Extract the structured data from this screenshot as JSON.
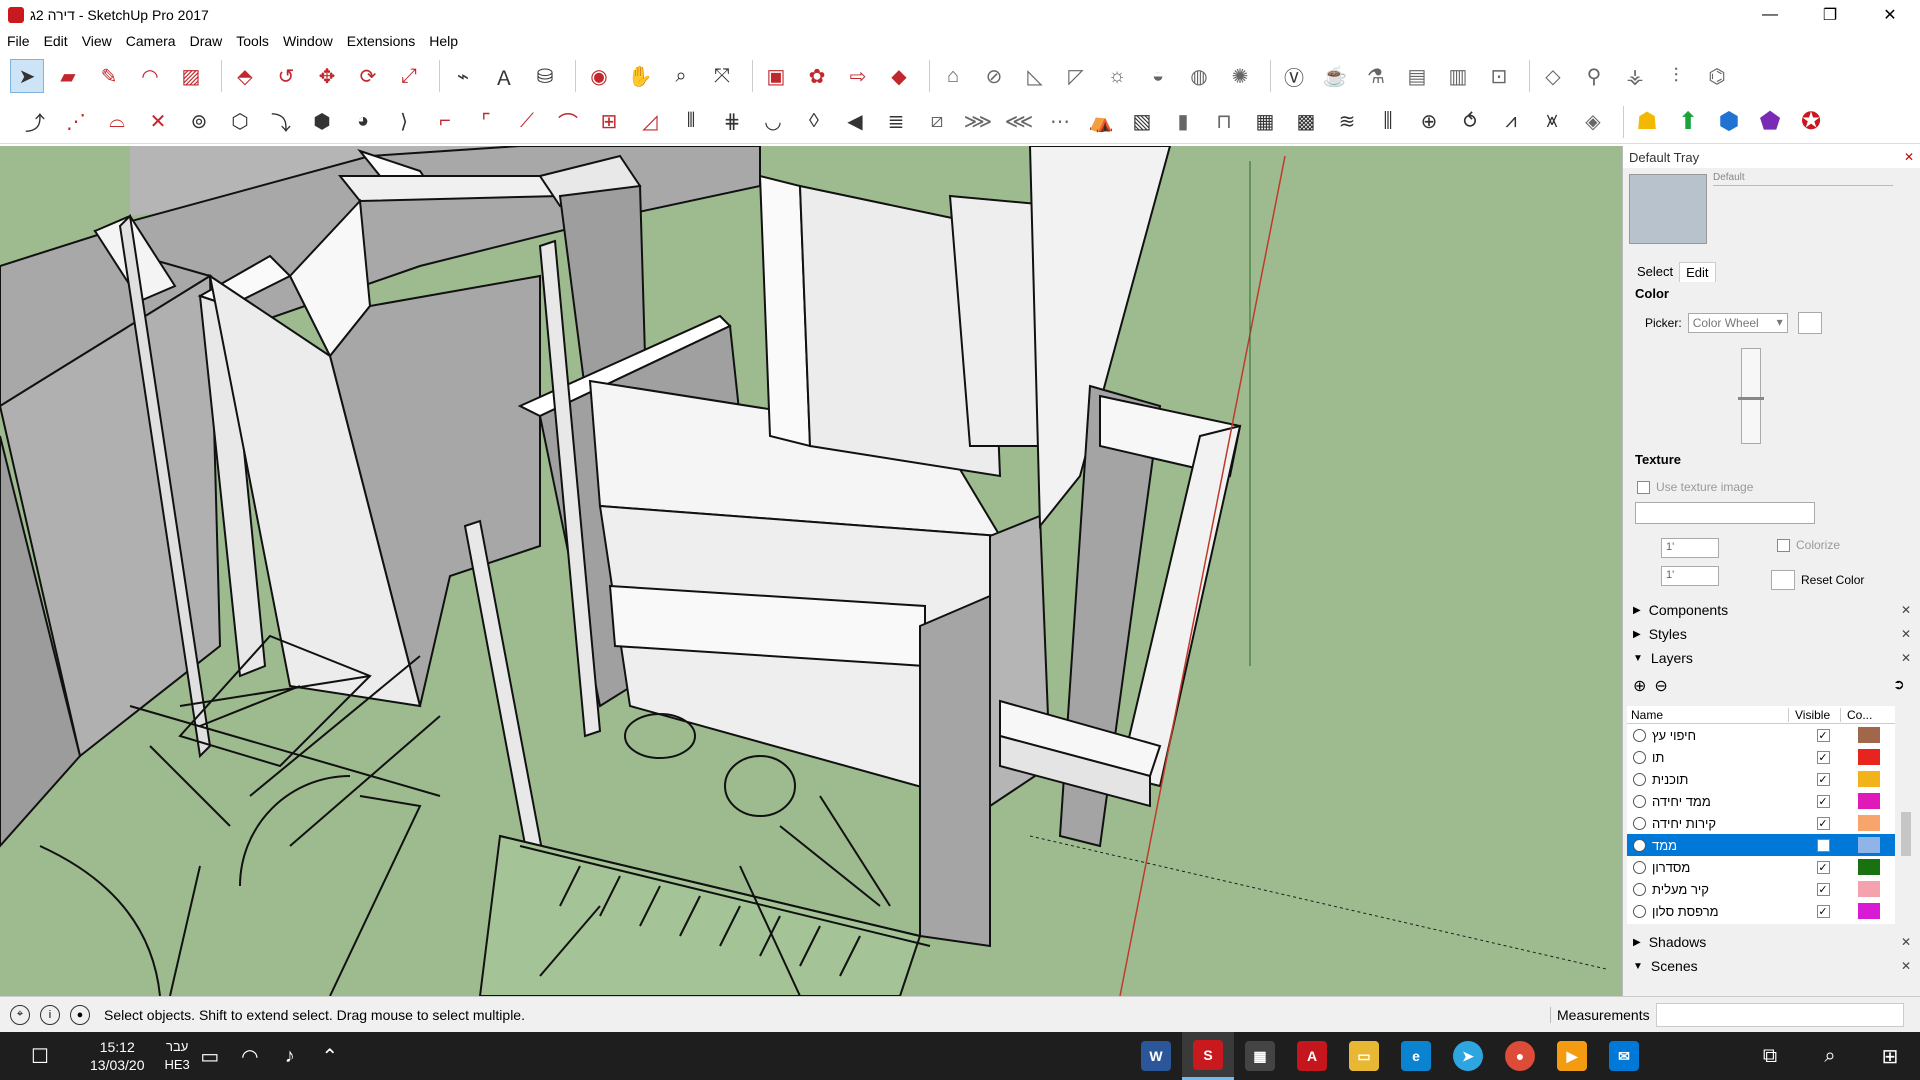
{
  "window": {
    "title": "דירה 2ג - SketchUp Pro 2017",
    "minimize": "—",
    "maximize": "❐",
    "close": "✕"
  },
  "menu": [
    "File",
    "Edit",
    "View",
    "Camera",
    "Draw",
    "Tools",
    "Window",
    "Extensions",
    "Help"
  ],
  "tray": {
    "title": "Default Tray",
    "material_name": "Default",
    "tab_select": "Select",
    "tab_edit": "Edit",
    "color_label": "Color",
    "picker_label": "Picker:",
    "picker_value": "Color Wheel",
    "texture_label": "Texture",
    "use_texture": "Use texture image",
    "width_value": "1'",
    "height_value": "1'",
    "colorize": "Colorize",
    "reset_color": "Reset Color",
    "panels": {
      "components": "Components",
      "styles": "Styles",
      "layers": "Layers",
      "shadows": "Shadows",
      "scenes": "Scenes"
    },
    "layers_columns": {
      "name": "Name",
      "visible": "Visible",
      "color": "Co..."
    },
    "layers": [
      {
        "name": "חיפוי עץ",
        "visible": "✓",
        "color": "#a0674b"
      },
      {
        "name": "תו",
        "visible": "✓",
        "color": "#e8241f"
      },
      {
        "name": "תוכנית",
        "visible": "✓",
        "color": "#f2b21a"
      },
      {
        "name": "ממד יחידה",
        "visible": "✓",
        "color": "#e01ab8"
      },
      {
        "name": "קירות יחידה",
        "visible": "✓",
        "color": "#f7a56c"
      },
      {
        "name": "ממד",
        "visible": "",
        "color": "#8fb4e8"
      },
      {
        "name": "מסדרון",
        "visible": "✓",
        "color": "#17720f"
      },
      {
        "name": "קיר מעלית",
        "visible": "✓",
        "color": "#f4a3ae"
      },
      {
        "name": "מרפסת סלון",
        "visible": "✓",
        "color": "#d91ad4"
      }
    ]
  },
  "status": {
    "message": "Select objects. Shift to extend select. Drag mouse to select multiple.",
    "measurements_label": "Measurements",
    "measurements_value": ""
  },
  "taskbar": {
    "time": "15:12",
    "date": "13/03/20",
    "lang_top": "עבר",
    "lang_bottom": "HE3",
    "apps": [
      {
        "name": "word",
        "label": "W",
        "color": "#2b579a"
      },
      {
        "name": "sketchup",
        "label": "S",
        "color": "#c8191f"
      },
      {
        "name": "calculator",
        "label": "▦",
        "color": "#444444"
      },
      {
        "name": "autocad",
        "label": "A",
        "color": "#c4161c"
      },
      {
        "name": "file-explorer",
        "label": "▭",
        "color": "#e8b835"
      },
      {
        "name": "edge",
        "label": "e",
        "color": "#0a84d0"
      },
      {
        "name": "telegram",
        "label": "➤",
        "color": "#2ca5e0"
      },
      {
        "name": "chrome",
        "label": "●",
        "color": "#dd4b39"
      },
      {
        "name": "media-player",
        "label": "▶",
        "color": "#f39c12"
      },
      {
        "name": "mail",
        "label": "✉",
        "color": "#0078d7"
      }
    ]
  }
}
